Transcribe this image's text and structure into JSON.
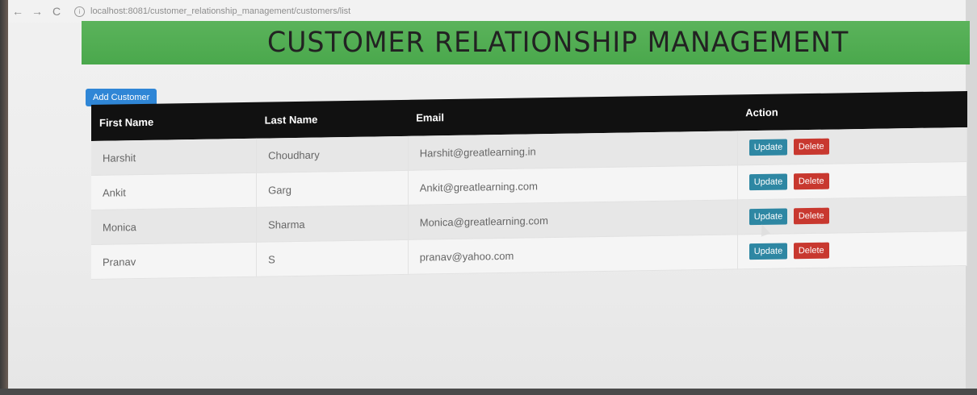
{
  "browser": {
    "url": "localhost:8081/customer_relationship_management/customers/list",
    "back_icon": "←",
    "forward_icon": "→",
    "reload_icon": "C",
    "info_icon": "i"
  },
  "header": {
    "title": "CUSTOMER RELATIONSHIP MANAGEMENT",
    "accent_color": "#4caf50"
  },
  "toolbar": {
    "add_label": "Add Customer",
    "add_color": "#2f86d6"
  },
  "table": {
    "columns": [
      "First Name",
      "Last Name",
      "Email",
      "Action"
    ],
    "rows": [
      {
        "first": "Harshit",
        "last": "Choudhary",
        "email": "Harshit@greatlearning.in",
        "update": "Update",
        "delete": "Delete"
      },
      {
        "first": "Ankit",
        "last": "Garg",
        "email": "Ankit@greatlearning.com",
        "update": "Update",
        "delete": "Delete"
      },
      {
        "first": "Monica",
        "last": "Sharma",
        "email": "Monica@greatlearning.com",
        "update": "Update",
        "delete": "Delete"
      },
      {
        "first": "Pranav",
        "last": "S",
        "email": "pranav@yahoo.com",
        "update": "Update",
        "delete": "Delete"
      }
    ],
    "update_color": "#2e87a3",
    "delete_color": "#c8382f"
  }
}
